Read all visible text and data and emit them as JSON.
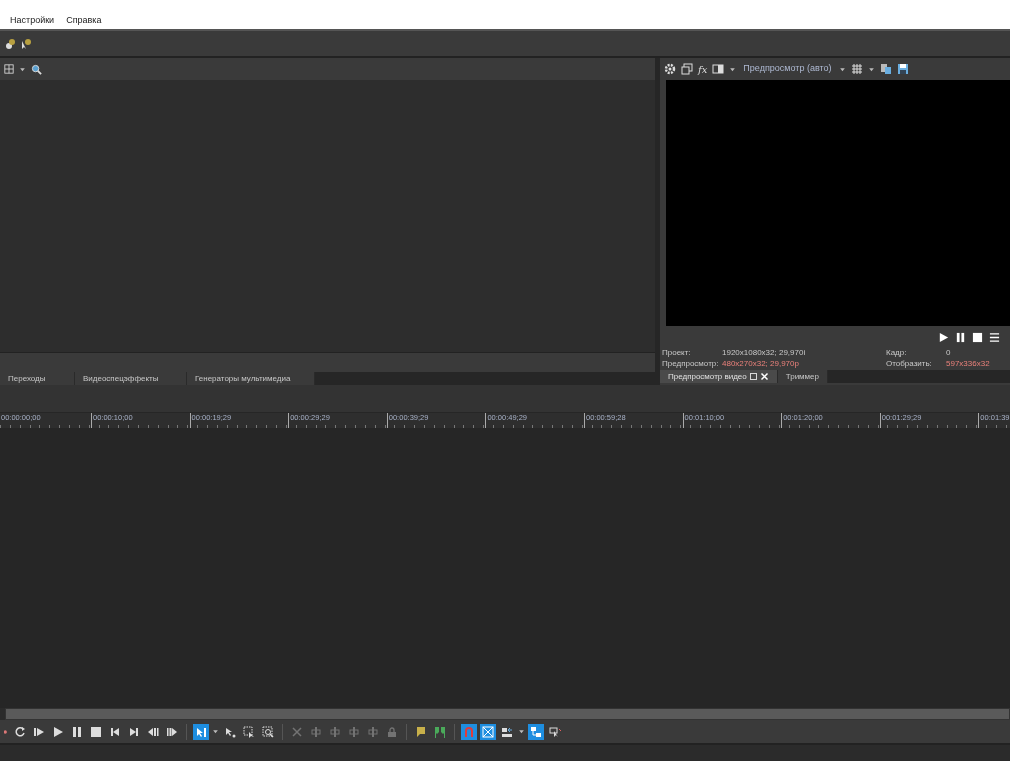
{
  "menu": [
    "Настройки",
    "Справка"
  ],
  "preview": {
    "toolbar_label": "fx",
    "quality": "Предпросмотр (авто)",
    "info": [
      {
        "label": "Проект:",
        "value": "1920x1080x32; 29,970i",
        "emphasis": false
      },
      {
        "label": "Предпросмотр:",
        "value": "480x270x32; 29,970p",
        "emphasis": true
      },
      {
        "label": "Кадр:",
        "value": "0",
        "emphasis": false
      },
      {
        "label": "Отобразить:",
        "value": "597x336x32",
        "emphasis": true
      }
    ],
    "tabs": [
      {
        "label": "Предпросмотр видео",
        "selected": true
      },
      {
        "label": "Триммер",
        "selected": false
      }
    ]
  },
  "media_tabs": [
    {
      "label": "Переходы",
      "selected": false
    },
    {
      "label": "Видеоспецэффекты",
      "selected": false
    },
    {
      "label": "Генераторы мультимедиа",
      "selected": false
    }
  ],
  "ruler": [
    "00:00:00;00",
    "00:00:10;00",
    "00:00:19;29",
    "00:00:29;29",
    "00:00:39;29",
    "00:00:49;29",
    "00:00:59;28",
    "00:01:10;00",
    "00:01:20;00",
    "00:01:29;29",
    "00:01:39"
  ],
  "timeline_toolbar": [
    {
      "kind": "loop",
      "selected": false,
      "disabled": false
    },
    {
      "kind": "play-start",
      "selected": false,
      "disabled": false
    },
    {
      "kind": "play",
      "selected": false,
      "disabled": false
    },
    {
      "kind": "pause",
      "selected": false,
      "disabled": false
    },
    {
      "kind": "stop",
      "selected": false,
      "disabled": false
    },
    {
      "kind": "prev",
      "selected": false,
      "disabled": false
    },
    {
      "kind": "next",
      "selected": false,
      "disabled": false
    },
    {
      "kind": "frame-back",
      "selected": false,
      "disabled": false
    },
    {
      "kind": "frame-fwd",
      "selected": false,
      "disabled": false
    },
    {
      "kind": "sep"
    },
    {
      "kind": "edit-tool",
      "selected": true,
      "disabled": false
    },
    {
      "kind": "caret"
    },
    {
      "kind": "envelope",
      "selected": false,
      "disabled": false
    },
    {
      "kind": "select",
      "selected": false,
      "disabled": false
    },
    {
      "kind": "zoom",
      "selected": false,
      "disabled": false
    },
    {
      "kind": "sep"
    },
    {
      "kind": "delete",
      "selected": false,
      "disabled": true
    },
    {
      "kind": "trim",
      "selected": false,
      "disabled": true
    },
    {
      "kind": "trim",
      "selected": false,
      "disabled": true
    },
    {
      "kind": "trim",
      "selected": false,
      "disabled": true
    },
    {
      "kind": "trim",
      "selected": false,
      "disabled": true
    },
    {
      "kind": "lock",
      "selected": false,
      "disabled": true
    },
    {
      "kind": "sep"
    },
    {
      "kind": "marker",
      "selected": false,
      "disabled": false
    },
    {
      "kind": "region",
      "selected": false,
      "disabled": false
    },
    {
      "kind": "sep"
    },
    {
      "kind": "snap",
      "selected": true,
      "disabled": false
    },
    {
      "kind": "crossfade",
      "selected": true,
      "disabled": false
    },
    {
      "kind": "ripple",
      "selected": false,
      "disabled": false
    },
    {
      "kind": "caret"
    },
    {
      "kind": "group-lock",
      "selected": true,
      "disabled": false
    },
    {
      "kind": "ignore-group",
      "selected": false,
      "disabled": false
    }
  ]
}
